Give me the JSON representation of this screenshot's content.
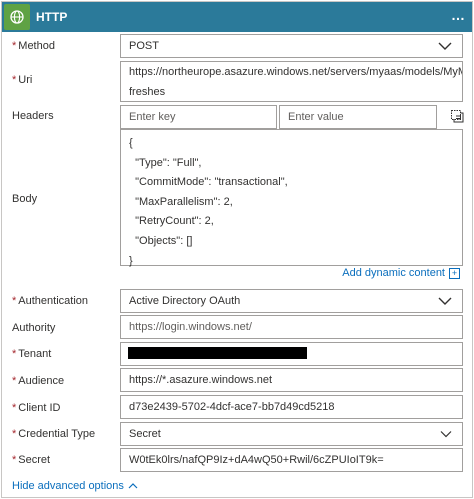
{
  "header": {
    "title": "HTTP",
    "more": "…"
  },
  "fields": {
    "method": {
      "label": "Method",
      "required": "*",
      "value": "POST"
    },
    "uri": {
      "label": "Uri",
      "required": "*",
      "line1": "https://northeurope.asazure.windows.net/servers/myaas/models/MyModel/re",
      "line2": "freshes"
    },
    "headers": {
      "label": "Headers",
      "key_placeholder": "Enter key",
      "value_placeholder": "Enter value"
    },
    "body": {
      "label": "Body",
      "lines": [
        "{",
        "  \"Type\": \"Full\",",
        "  \"CommitMode\": \"transactional\",",
        "  \"MaxParallelism\": 2,",
        "  \"RetryCount\": 2,",
        "  \"Objects\": []",
        "}"
      ]
    },
    "dynamic_content": {
      "label": "Add dynamic content",
      "icon": "+"
    },
    "authentication": {
      "label": "Authentication",
      "required": "*",
      "value": "Active Directory OAuth"
    },
    "authority": {
      "label": "Authority",
      "placeholder": "https://login.windows.net/"
    },
    "tenant": {
      "label": "Tenant",
      "required": "*"
    },
    "audience": {
      "label": "Audience",
      "required": "*",
      "value": "https://*.asazure.windows.net"
    },
    "client_id": {
      "label": "Client ID",
      "required": "*",
      "value": "d73e2439-5702-4dcf-ace7-bb7d49cd5218"
    },
    "credential_type": {
      "label": "Credential Type",
      "required": "*",
      "value": "Secret"
    },
    "secret": {
      "label": "Secret",
      "required": "*",
      "value": "W0tEk0lrs/nafQP9Iz+dA4wQ50+Rwil/6cZPUIoIT9k="
    }
  },
  "footer": {
    "hide_advanced": "Hide advanced options"
  },
  "colors": {
    "header_bg": "#2b7a9a",
    "icon_bg": "#5fa244",
    "link": "#0a6ebd",
    "required": "#a4262c"
  }
}
